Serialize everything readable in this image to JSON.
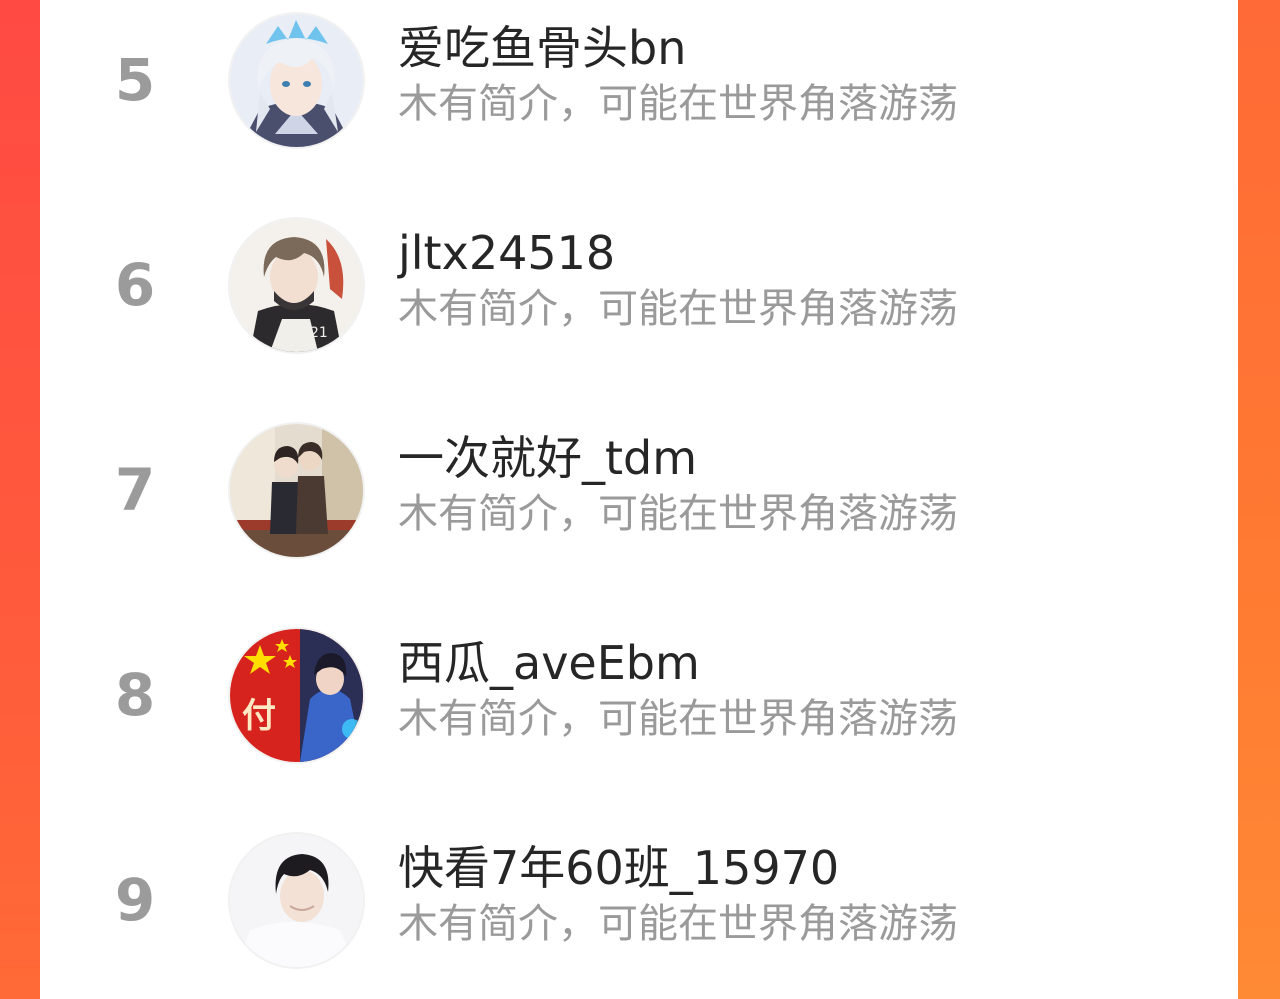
{
  "leaderboard": {
    "entries": [
      {
        "rank": "5",
        "name": "爱吃鱼骨头bn",
        "bio": "木有简介，可能在世界角落游荡",
        "avatar_icon": "anime-silver-hair-avatar"
      },
      {
        "rank": "6",
        "name": "jltx24518",
        "bio": "木有简介，可能在世界角落游荡",
        "avatar_icon": "anime-brown-hair-avatar"
      },
      {
        "rank": "7",
        "name": "一次就好_tdm",
        "bio": "木有简介，可能在世界角落游荡",
        "avatar_icon": "anime-couple-avatar"
      },
      {
        "rank": "8",
        "name": "西瓜_aveEbm",
        "bio": "木有简介，可能在世界角落游荡",
        "avatar_icon": "red-flag-character-avatar",
        "avatar_text": "付"
      },
      {
        "rank": "9",
        "name": "快看7年60班_15970",
        "bio": "木有简介，可能在世界角落游荡",
        "avatar_icon": "boy-portrait-avatar"
      }
    ]
  },
  "colors": {
    "accent_left": "#ff4a43",
    "accent_right": "#ff7b32",
    "rank_text": "#9b9b9b",
    "name_text": "#262626",
    "bio_text": "#9a9a9a"
  }
}
